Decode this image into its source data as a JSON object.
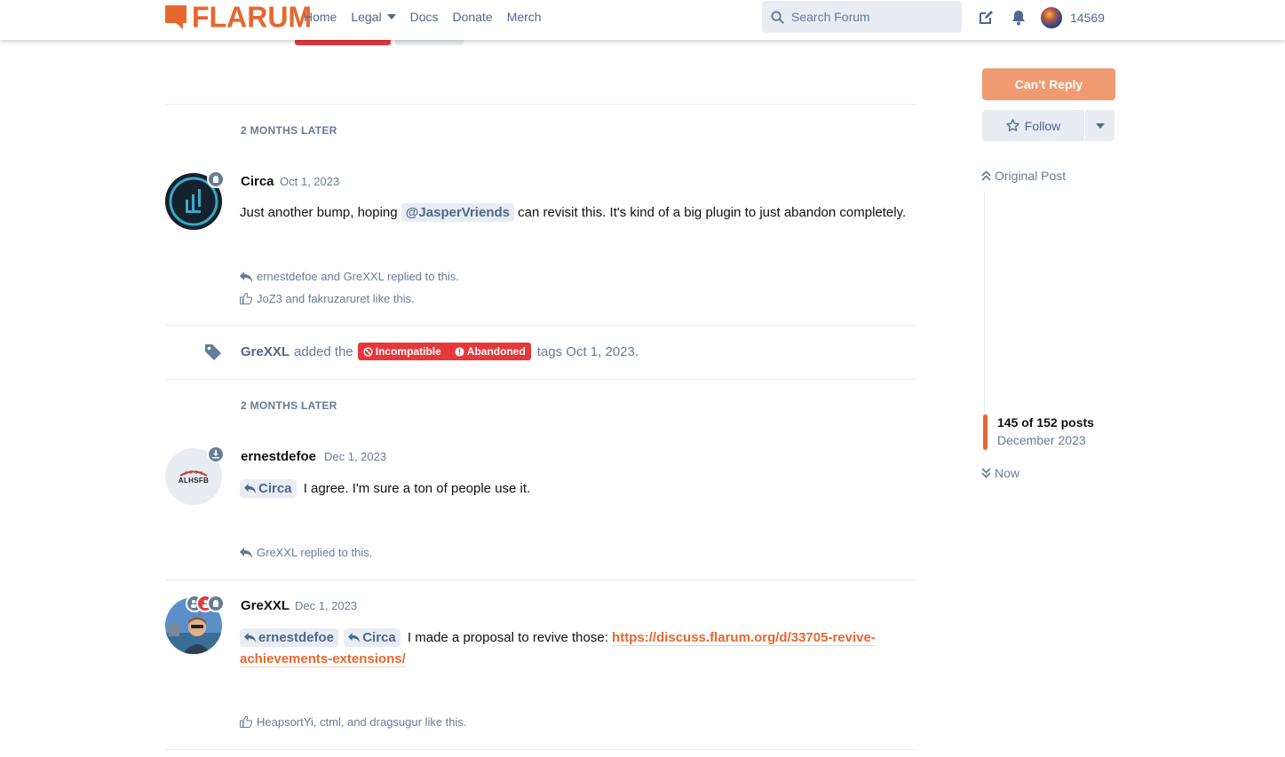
{
  "header": {
    "logo_text": "FLARUM",
    "nav": [
      {
        "label": "Home"
      },
      {
        "label": "Legal"
      },
      {
        "label": "Docs"
      },
      {
        "label": "Donate"
      },
      {
        "label": "Merch"
      }
    ],
    "search_placeholder": "Search Forum",
    "icons": [
      "compose-icon",
      "bell-icon"
    ],
    "username": "14569"
  },
  "stream": {
    "gap_labels": [
      "2 MONTHS LATER",
      "2 MONTHS LATER"
    ],
    "posts": [
      {
        "author": "Circa",
        "date": "Oct 1, 2023",
        "text_before": "Just another bump, hoping",
        "mention": "@JasperVriends",
        "text_after": "can revisit this. It's kind of a big plugin to just abandon completely.",
        "replied_line": "ernestdefoe and GreXXL replied to this.",
        "likes_line": "JoZ3 and fakruzaruret like this."
      },
      {
        "author": "ernestdefoe",
        "date": "Dec 1, 2023",
        "avatar_text": "ALHSFB",
        "reply_to": "Circa",
        "text": "I agree. I'm sure a ton of people use it.",
        "replied_line": "GreXXL replied to this."
      },
      {
        "author": "GreXXL",
        "date": "Dec 1, 2023",
        "reply_to_1": "ernestdefoe",
        "reply_to_2": "Circa",
        "text": "I made a proposal to revive those:",
        "link_line1": "https://discuss.flarum.org/d/33705-revive-",
        "link_line2": "achievements-extensions/",
        "likes_line": "HeapsortYi, ctml, and dragsugur like this."
      }
    ],
    "event": {
      "actor": "GreXXL",
      "action": "added the",
      "tags": [
        "Incompatible",
        "Abandoned"
      ],
      "suffix": "tags Oct 1, 2023."
    }
  },
  "sidebar": {
    "cant_reply_label": "Can't Reply",
    "follow_label": "Follow",
    "original_post_label": "Original Post",
    "scrub_count": "145 of 152 posts",
    "scrub_date": "December 2023",
    "now_label": "Now"
  },
  "colors": {
    "accent": "#e7672e",
    "muted": "#667c99",
    "tag_red": "#e5383b",
    "control_bg": "#e8ecf3"
  }
}
